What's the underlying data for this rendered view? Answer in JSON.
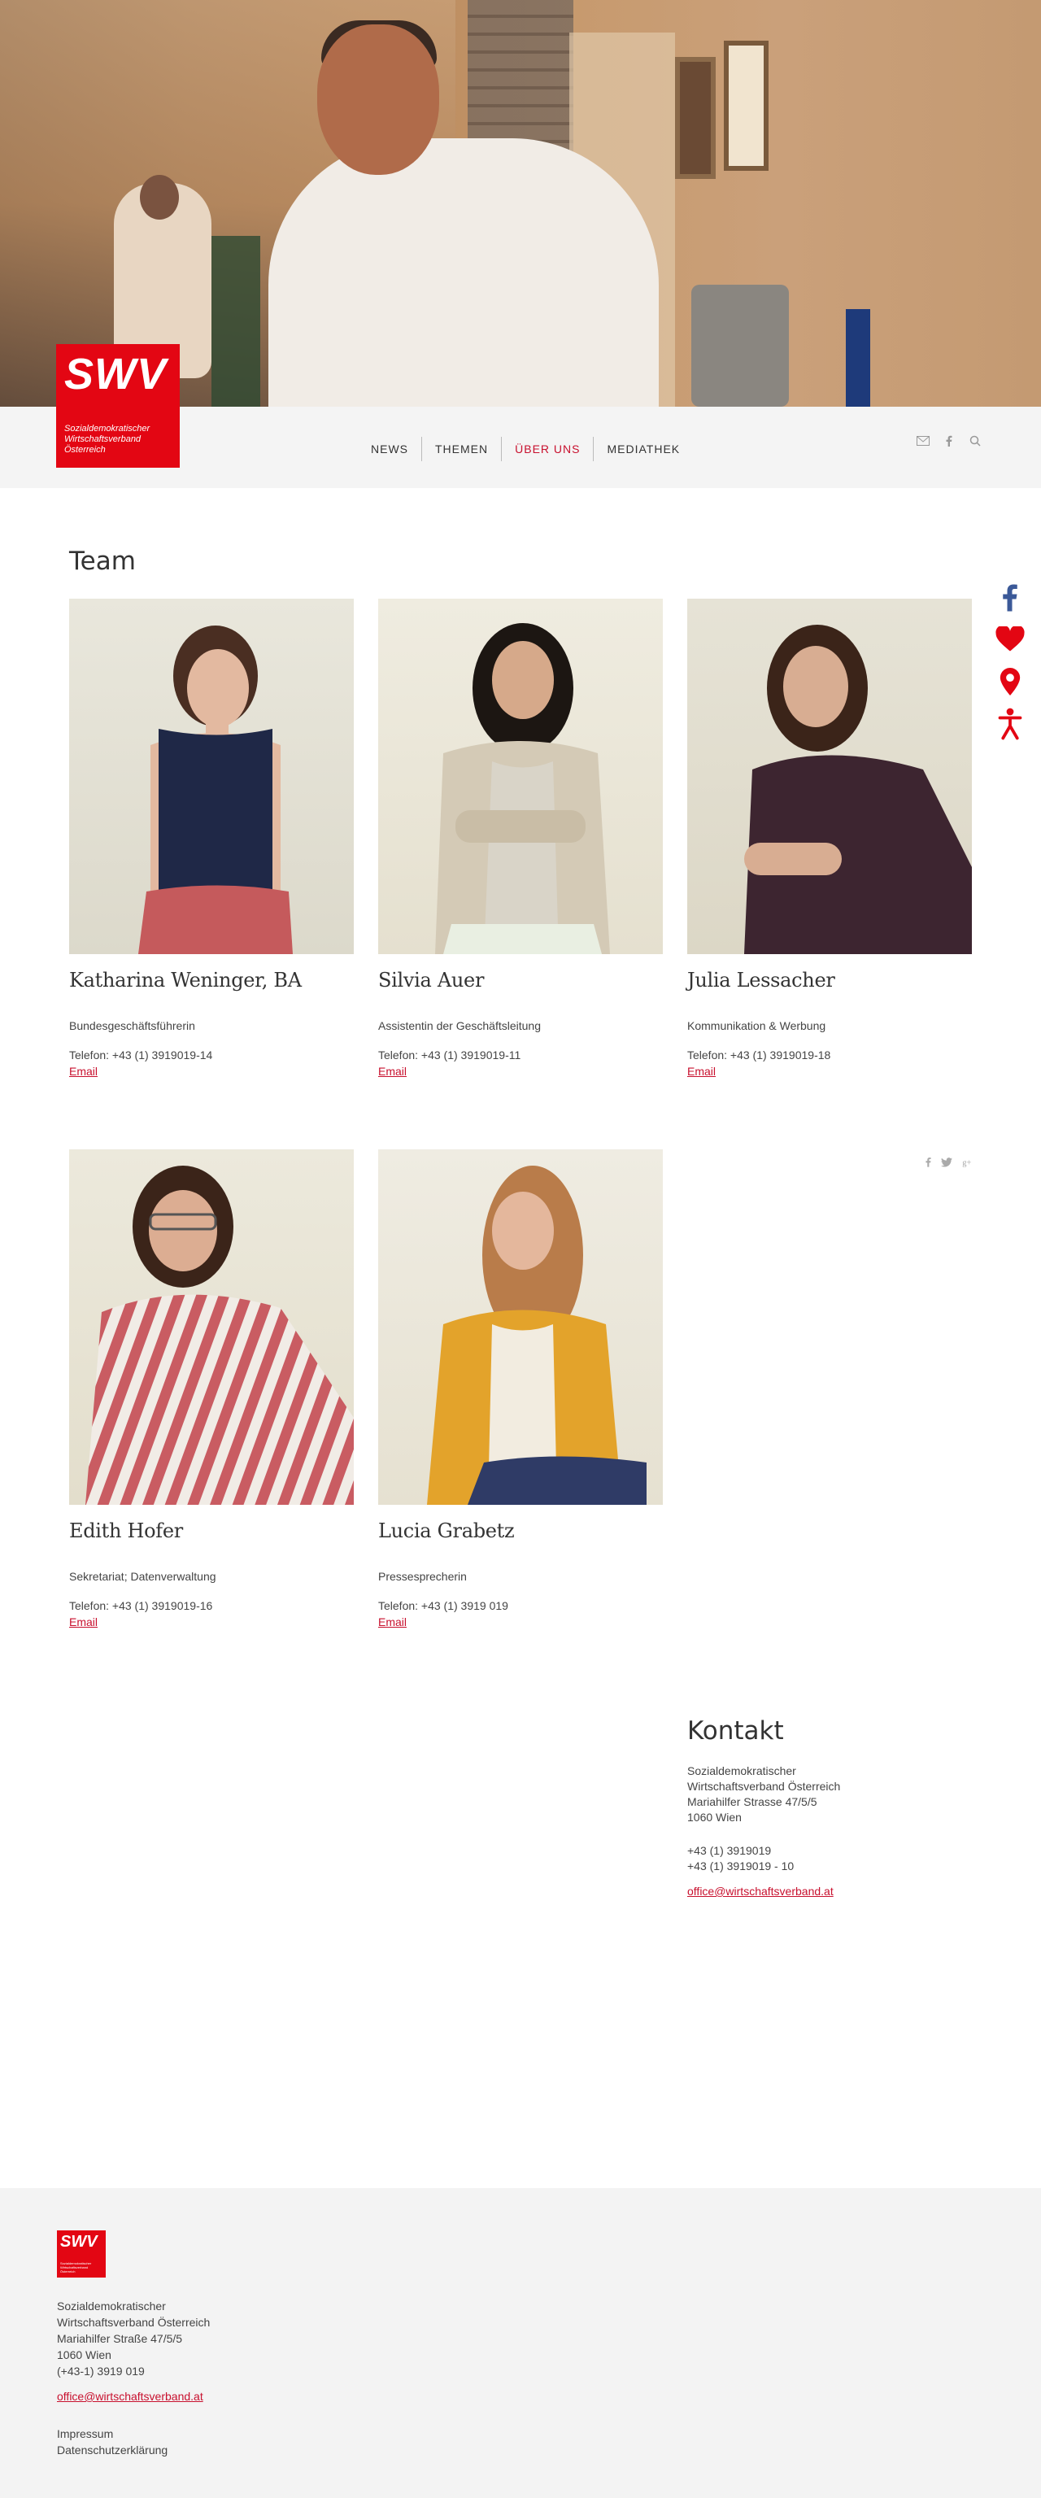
{
  "logo": {
    "mark": "SWV",
    "sub_line1": "Sozialdemokratischer",
    "sub_line2": "Wirtschaftsverband",
    "sub_line3": "Österreich"
  },
  "nav": {
    "items": [
      {
        "label": "NEWS",
        "active": false
      },
      {
        "label": "THEMEN",
        "active": false
      },
      {
        "label": "ÜBER UNS",
        "active": true
      },
      {
        "label": "MEDIATHEK",
        "active": false
      }
    ]
  },
  "nav_icons": [
    "mail-icon",
    "facebook-icon",
    "search-icon"
  ],
  "side_icons": [
    "facebook-icon",
    "heart-icon",
    "location-pin-icon",
    "accessibility-icon"
  ],
  "colors": {
    "brand_red": "#e30613",
    "link_red": "#c8102e",
    "nav_bg": "#f4f4f4",
    "footer_bg": "#f3f3f3"
  },
  "team": {
    "title": "Team",
    "members": [
      {
        "name": "Katharina Weninger, BA",
        "role": "Bundesgeschäftsführerin",
        "phone": "Telefon: +43 (1) 3919019-14",
        "email_label": "Email"
      },
      {
        "name": "Silvia Auer",
        "role": "Assistentin der Geschäftsleitung",
        "phone": "Telefon: +43 (1) 3919019-11",
        "email_label": "Email"
      },
      {
        "name": "Julia Lessacher",
        "role": "Kommunikation & Werbung",
        "phone": "Telefon: +43 (1) 3919019-18",
        "email_label": "Email"
      },
      {
        "name": "Edith Hofer",
        "role": "Sekretariat; Datenverwaltung",
        "phone": "Telefon: +43 (1) 3919019-16",
        "email_label": "Email"
      },
      {
        "name": "Lucia Grabetz",
        "role": "Pressesprecherin",
        "phone": "Telefon: +43 (1) 3919 019",
        "email_label": "Email"
      }
    ]
  },
  "share_icons": [
    "facebook-icon",
    "twitter-icon",
    "google-plus-icon"
  ],
  "kontakt": {
    "title": "Kontakt",
    "addr1": "Sozialdemokratischer",
    "addr2": "Wirtschaftsverband Österreich",
    "addr3": "Mariahilfer Strasse 47/5/5",
    "addr4": "1060 Wien",
    "phone1": "+43 (1) 3919019",
    "phone2": "+43 (1) 3919019 - 10",
    "email": "office@wirtschaftsverband.at"
  },
  "footer": {
    "addr1": "Sozialdemokratischer",
    "addr2": "Wirtschaftsverband Österreich",
    "addr3": "Mariahilfer Straße 47/5/5",
    "addr4": "1060 Wien",
    "phone": "(+43-1) 3919 019",
    "email": "office@wirtschaftsverband.at",
    "link1": "Impressum",
    "link2": "Datenschutzerklärung"
  }
}
